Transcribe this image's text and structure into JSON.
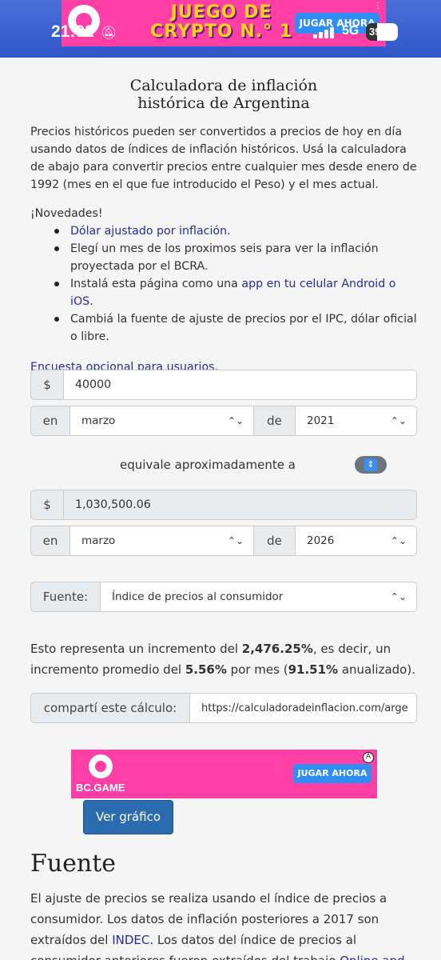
{
  "status": {
    "time": "21:02",
    "network": "5G",
    "battery": "39"
  },
  "ad_top": {
    "headline_line1": "JUEGO DE",
    "headline_line2": "CRYPTO N.° 1",
    "cta": "JUGAR AHORA"
  },
  "page": {
    "title_line1": "Calculadora de inflación",
    "title_line2": "histórica de Argentina",
    "intro": "Precios históricos pueden ser convertidos a precios de hoy en día usando datos de índices de inflación históricos. Usá la calculadora de abajo para convertir precios entre cualquier mes desde enero de 1992 (mes en el que fue introducido el Peso) y el mes actual.",
    "news_title": "¡Novedades!",
    "news": {
      "item1_link": "Dólar ajustado por inflación",
      "item1_tail": ".",
      "item2": "Elegí un mes de los proximos seis para ver la inflación proyectada por el BCRA.",
      "item3_pre": "Instalá esta página como una ",
      "item3_link": "app en tu celular Android o iOS",
      "item3_tail": ".",
      "item4": "Cambiá la fuente de ajuste de precios por el IPC, dólar oficial o libre."
    },
    "survey_link": "Encuesta opcional para usuarios."
  },
  "form": {
    "currency_symbol": "$",
    "amount_value": "40000",
    "label_en": "en",
    "label_de": "de",
    "from_month": "marzo",
    "from_year": "2021",
    "equiv_text": "equivale aproximadamente a",
    "result_value": "1,030,500.06",
    "to_month": "marzo",
    "to_year": "2026",
    "source_label": "Fuente:",
    "source_value": "Índice de precios al consumidor",
    "share_label": "compartí este cálculo:",
    "share_url": "https://calculadoradeinflacion.com/arge"
  },
  "result": {
    "pre": "Esto representa un incremento del ",
    "pct_total": "2,476.25%",
    "mid": ", es decir, un incremento promedio del ",
    "pct_month": "5.56%",
    "mid2": " por mes (",
    "pct_year": "91.51%",
    "tail": " anualizado)."
  },
  "ad_mid": {
    "brand": "BC.GAME",
    "cta": "JUGAR AHORA",
    "adinfo": "A"
  },
  "chart_button": "Ver gráfico",
  "fuente": {
    "title": "Fuente",
    "text_pre": "El ajuste de precios se realiza usando el índice de precios a consumidor. Los datos de inflación posteriores a 2017 son extraídos del ",
    "link_indec": "INDEC",
    "text_mid": ". Los datos del índice de precios al consumidor anteriores fueron extraídos del trabajo ",
    "link_work": "Online and"
  }
}
